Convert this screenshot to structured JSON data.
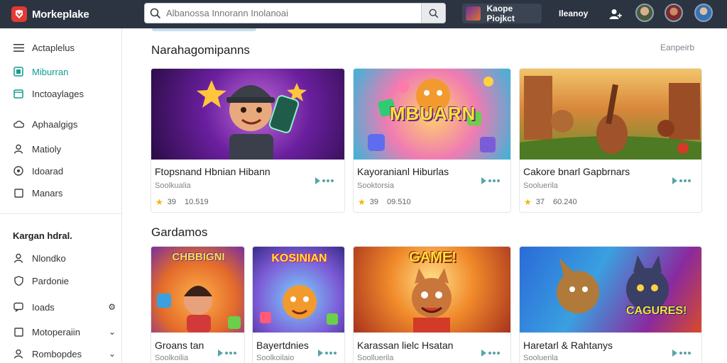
{
  "header": {
    "app_name": "Morkeplake",
    "search_placeholder": "Albanossa Innorann Inolanoai",
    "project_name": "Kaope Piojkct",
    "nav_link": "Ileanoy"
  },
  "sidebar": {
    "items": [
      {
        "label": "Actaplelus",
        "icon": "menu-icon"
      },
      {
        "label": "Miburran",
        "icon": "app-icon",
        "active": true
      },
      {
        "label": "Inctoaylages",
        "icon": "calendar-icon"
      },
      {
        "label": "Aphaalgigs",
        "icon": "cloud-icon"
      },
      {
        "label": "Matioly",
        "icon": "user-icon"
      },
      {
        "label": "Idoarad",
        "icon": "target-icon"
      },
      {
        "label": "Manars",
        "icon": "square-icon"
      }
    ],
    "section_heading": "Kargan hdral.",
    "section_items": [
      {
        "label": "Nlondko",
        "icon": "user-icon"
      },
      {
        "label": "Pardonie",
        "icon": "shield-icon"
      },
      {
        "label": "Ioads",
        "icon": "chat-icon",
        "trail": "⚙"
      },
      {
        "label": "Motoperaiin",
        "icon": "square-icon",
        "trail": "⌄"
      },
      {
        "label": "Rombopdes",
        "icon": "user-icon",
        "trail": "⌄"
      }
    ]
  },
  "main": {
    "section1_title": "Narahagomipanns",
    "section1_link": "Eanpeirb",
    "section2_title": "Gardamos",
    "cards_row1": [
      {
        "title": "Ftopsnand Hbnian Hibann",
        "sub": "Soolkualia",
        "rating": "39",
        "count": "10.519"
      },
      {
        "title": "Kayoranianl Hiburlas",
        "sub": "Sooktorsia",
        "rating": "39",
        "count": "09.510"
      },
      {
        "title": "Cakore bnarl Gapbrnars",
        "sub": "Sooluerila",
        "rating": "37",
        "count": "60.240"
      }
    ],
    "cards_row2": [
      {
        "title": "Groans tan",
        "sub": "Soolkoilia",
        "img_text": "CHBBIGNI"
      },
      {
        "title": "Bayertdnies",
        "sub": "Soolkoilaio",
        "img_text": "KOSINIAN"
      },
      {
        "title": "Karassan lielc Hsatan",
        "sub": "Soolluerila",
        "img_text": "GAME!"
      },
      {
        "title": "Haretarl & Rahtanys",
        "sub": "Sooluerila",
        "img_text": "CAGURES!"
      }
    ],
    "row1_img_text": [
      "",
      "MBUARN",
      ""
    ]
  },
  "colors": {
    "topbar": "#2b3440",
    "accent": "#0f9d8f",
    "star": "#f4b400"
  }
}
